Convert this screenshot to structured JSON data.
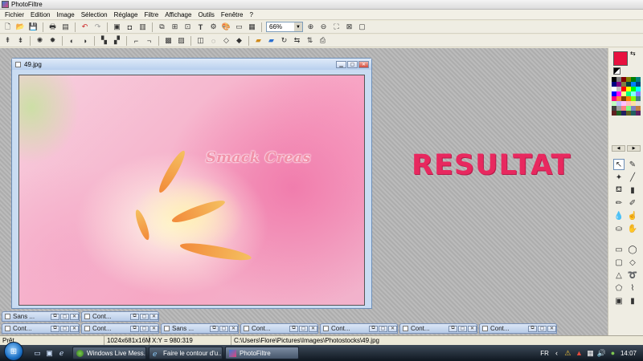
{
  "app": {
    "title": "PhotoFiltre"
  },
  "menu": [
    "Fichier",
    "Edition",
    "Image",
    "Sélection",
    "Réglage",
    "Filtre",
    "Affichage",
    "Outils",
    "Fenêtre",
    "?"
  ],
  "toolbar": {
    "zoom_value": "66%",
    "text_tool_glyph": "T"
  },
  "workspace": {
    "result_text": "RESULTAT"
  },
  "image_window": {
    "title": "49.jpg",
    "watermark": "Smack Creas"
  },
  "colors": {
    "foreground": "#e8103e",
    "accent_text": "#e8285f"
  },
  "minimized_windows_row1": [
    {
      "label": "Sans ..."
    },
    {
      "label": "Cont..."
    }
  ],
  "minimized_windows_row2": [
    {
      "label": "Cont..."
    },
    {
      "label": "Cont..."
    },
    {
      "label": "Sans ..."
    },
    {
      "label": "Cont..."
    },
    {
      "label": "Cont..."
    },
    {
      "label": "Cont..."
    },
    {
      "label": "Cont..."
    }
  ],
  "statusbar": {
    "status": "Prêt",
    "dimensions": "1024x681x16M",
    "coords": "X:Y = 980:319",
    "path": "C:\\Users\\Flore\\Pictures\\Images\\Photostocks\\49.jpg"
  },
  "taskbar": {
    "tasks": [
      {
        "label": "Windows Live Mess..."
      },
      {
        "label": "Faire le contour d'u..."
      },
      {
        "label": "PhotoFiltre"
      }
    ],
    "language": "FR",
    "clock": "14:07"
  },
  "icons": {
    "palette_swap": "swap-colors-icon",
    "start": "windows-start-icon"
  }
}
